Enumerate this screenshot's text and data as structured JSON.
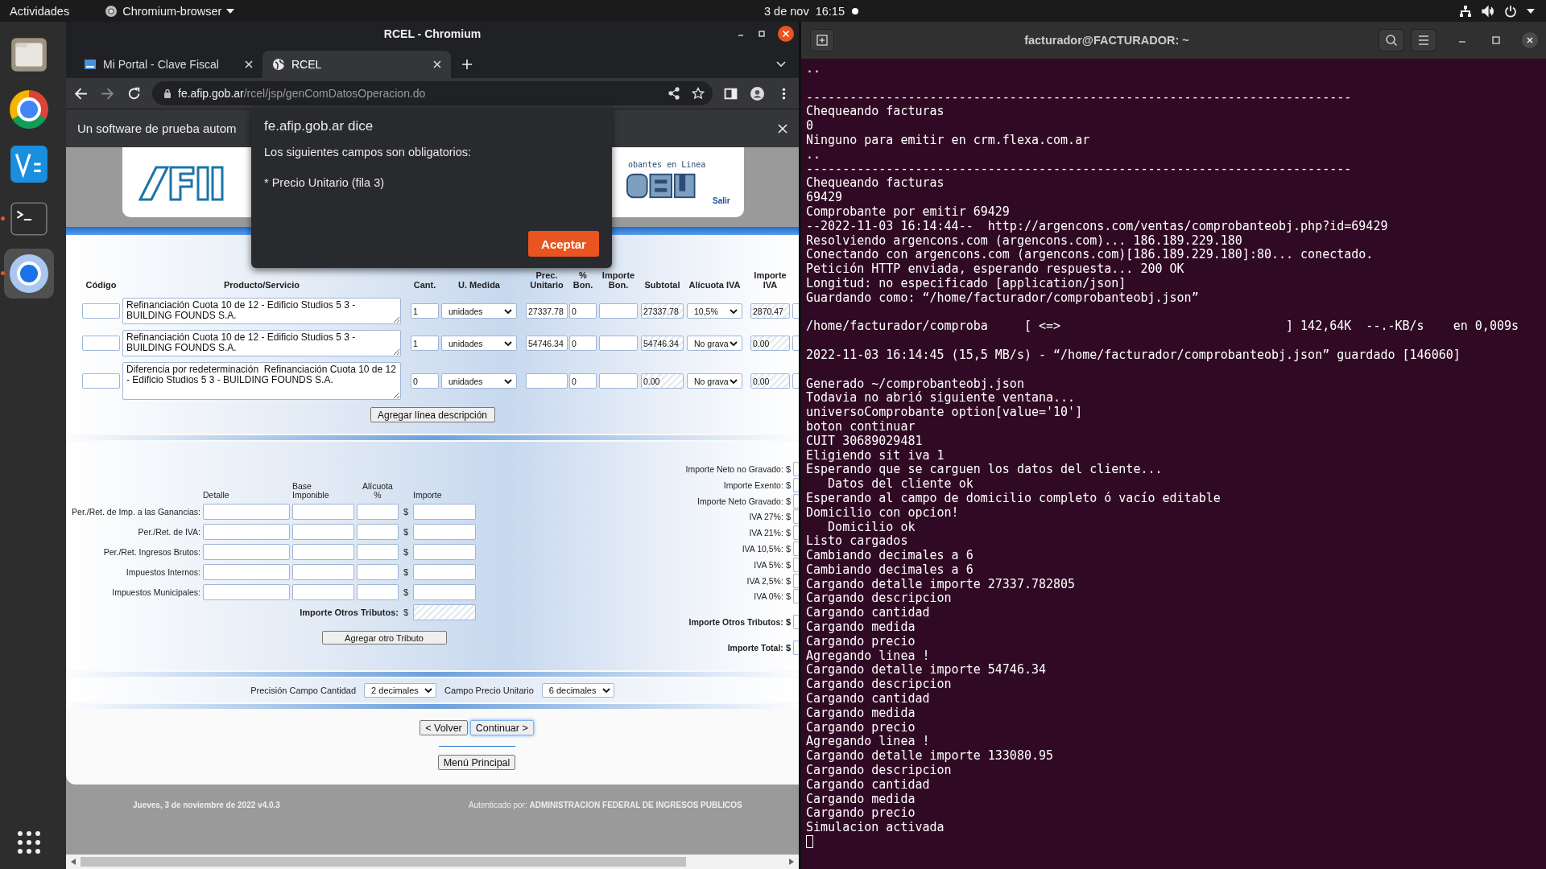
{
  "top_bar": {
    "activities": "Actividades",
    "app_menu": "Chromium-browser",
    "date": "3 de nov",
    "time": "16:15"
  },
  "dock": {
    "items": [
      {
        "kind": "files",
        "running": false,
        "selected": false
      },
      {
        "kind": "chrome",
        "running": false,
        "selected": false
      },
      {
        "kind": "vnc",
        "running": false,
        "selected": false
      },
      {
        "kind": "terminal",
        "running": true,
        "selected": false
      },
      {
        "kind": "chromium",
        "running": true,
        "selected": true
      }
    ]
  },
  "browser": {
    "title": "RCEL - Chromium",
    "tabs": [
      {
        "label": "Mi Portal - Clave Fiscal",
        "kind": "portal",
        "selected": false
      },
      {
        "label": "RCEL",
        "kind": "globe",
        "selected": true
      }
    ],
    "url_host": "fe.afip.gob.ar",
    "url_path": "/rcel/jsp/genComDatosOperacion.do",
    "infobar": "Un software de prueba autom"
  },
  "dialog": {
    "origin": "fe.afip.gob.ar dice",
    "message": "Los siguientes campos son obligatorios:",
    "detail": "* Precio Unitario (fila 3)",
    "button": "Aceptar"
  },
  "page": {
    "header": {
      "subtitle": "obantes en Linea",
      "logout": "Salir"
    },
    "items_table": {
      "columns": [
        "Código",
        "Producto/Servicio",
        "Cant.",
        "U. Medida",
        "Prec. Unitario",
        "% Bon.",
        "Importe Bon.",
        "Subtotal",
        "Alícuota IVA",
        "Importe IVA"
      ],
      "rows": [
        {
          "description": "Refinanciación Cuota 10 de 12 - Edificio Studios 5 3 - BUILDING FOUNDS S.A.",
          "quantity": "1",
          "unit": "unidades",
          "unit_price": "27337.78",
          "discount_pct": "0",
          "subtotal": "27337.78",
          "vat_rate": "10,5%",
          "vat_amount": "2870.47"
        },
        {
          "description": "Refinanciación Cuota 10 de 12 - Edificio Studios 5 3 - BUILDING FOUNDS S.A.",
          "quantity": "1",
          "unit": "unidades",
          "unit_price": "54746.34",
          "discount_pct": "0",
          "subtotal": "54746.34",
          "vat_rate": "No grava",
          "vat_amount": "0.00"
        },
        {
          "description": "Diferencia por redeterminación  Refinanciación Cuota 10 de 12 - Edificio Studios 5 3 - BUILDING FOUNDS S.A.",
          "quantity": "0",
          "unit": "unidades",
          "discount_pct": "0",
          "subtotal": "0.00",
          "vat_rate": "No grava",
          "vat_amount": "0.00"
        }
      ]
    },
    "add_line_button": "Agregar línea descripción",
    "tributes": {
      "columns": [
        "Detalle",
        "Base Imponible",
        "Alícuota %",
        "Importe"
      ],
      "rows": [
        {
          "label": "Per./Ret. de Imp. a las Ganancias:"
        },
        {
          "label": "Per./Ret. de IVA:"
        },
        {
          "label": "Per./Ret. Ingresos Brutos:"
        },
        {
          "label": "Impuestos Internos:"
        },
        {
          "label": "Impuestos Municipales:"
        }
      ],
      "currency": "$",
      "total_label": "Importe Otros Tributos:",
      "add_button": "Agregar otro Tributo"
    },
    "totals": [
      {
        "label": "Importe Neto no Gravado:",
        "kind": "line"
      },
      {
        "label": "Importe Exento:",
        "kind": "line"
      },
      {
        "label": "Importe Neto Gravado:",
        "kind": "line"
      },
      {
        "label": "IVA 27%:",
        "kind": "line"
      },
      {
        "label": "IVA 21%:",
        "kind": "line"
      },
      {
        "label": "IVA 10,5%:",
        "kind": "line"
      },
      {
        "label": "IVA 5%:",
        "kind": "line"
      },
      {
        "label": "IVA 2,5%:",
        "kind": "line"
      },
      {
        "label": "IVA 0%:",
        "kind": "line"
      },
      {
        "label": "Importe Otros Tributos:",
        "kind": "summary"
      },
      {
        "label": "Importe Total:",
        "kind": "summary"
      }
    ],
    "precision": {
      "quantity_label": "Precisión Campo Cantidad",
      "quantity_value": "2 decimales",
      "price_label": "Campo Precio Unitario",
      "price_value": "6 decimales"
    },
    "back_button": "< Volver",
    "continue_button": "Continuar >",
    "main_menu_button": "Menú Principal",
    "footer": {
      "date": "Jueves, 3 de noviembre de 2022 v4.0.3",
      "authenticated": "Autenticado por: **ADMINISTRACION FEDERAL DE INGRESOS PUBLICOS**"
    }
  },
  "terminal": {
    "title": "facturador@FACTURADOR: ~",
    "blocks": [
      [
        ".."
      ],
      [
        "---------------------------------------------------------------------------",
        "Chequeando facturas",
        "0",
        "Ninguno para emitir en crm.flexa.com.ar",
        "..",
        "---------------------------------------------------------------------------",
        "Chequeando facturas",
        "69429",
        "Comprobante por emitir 69429",
        "--2022-11-03 16:14:44--  http://argencons.com/ventas/comprobanteobj.php?id=69429",
        "Resolviendo argencons.com (argencons.com)... 186.189.229.180",
        "Conectando con argencons.com (argencons.com)[186.189.229.180]:80... conectado.",
        "Petición HTTP enviada, esperando respuesta... 200 OK",
        "Longitud: no especificado [application/json]",
        "Guardando como: “/home/facturador/comprobanteobj.json”"
      ],
      [
        "/home/facturador/comproba     [ <=>                               ] 142,64K  --.-KB/s    en 0,009s"
      ],
      [
        "2022-11-03 16:14:45 (15,5 MB/s) - “/home/facturador/comprobanteobj.json” guardado [146060]"
      ],
      [
        "Generado ~/comprobanteobj.json",
        "Todavia no abrió siguiente ventana...",
        "universoComprobante option[value='10']",
        "boton continuar",
        "CUIT 30689029481",
        "Eligiendo sit iva 1",
        "Esperando que se carguen los datos del cliente...",
        "   Datos del cliente ok",
        "Esperando al campo de domicilio completo ó vacío editable",
        "Domicilio con opcion!",
        "   Domicilio ok",
        "Listo cargados",
        "Cambiando decimales a 6",
        "Cambiando decimales a 6",
        "Cargando detalle importe 27337.782805",
        "Cargando descripcion",
        "Cargando cantidad",
        "Cargando medida",
        "Cargando precio",
        "Agregando linea !",
        "Cargando detalle importe 54746.34",
        "Cargando descripcion",
        "Cargando cantidad",
        "Cargando medida",
        "Cargando precio",
        "Agregando linea !",
        "Cargando detalle importe 133080.95",
        "Cargando descripcion",
        "Cargando cantidad",
        "Cargando medida",
        "Cargando precio",
        "Simulacion activada"
      ]
    ]
  }
}
